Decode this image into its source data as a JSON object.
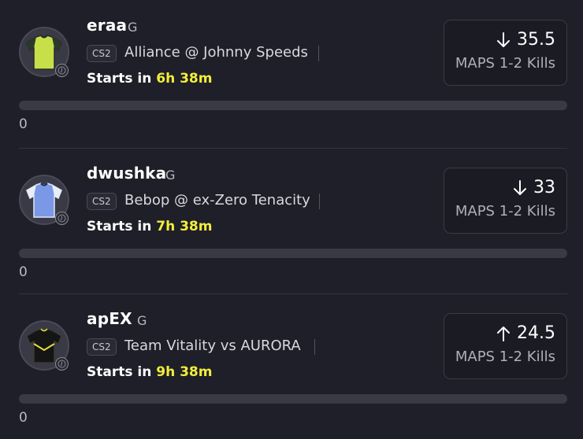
{
  "cards": [
    {
      "player": "eraa",
      "position": "G",
      "game": "CS2",
      "matchup": "Alliance @ Johnny Speeds",
      "starts_prefix": "Starts in",
      "starts_time": "6h 38m",
      "direction": "down",
      "stat_value": "35.5",
      "stat_label": "MAPS 1-2 Kills",
      "progress_value": "0",
      "progress_fraction": 0,
      "jersey_color": "#c7e04a",
      "jersey_trim": "#2a2a2a",
      "jersey_sleeve": "#2a3a2a"
    },
    {
      "player": "dwushka",
      "position": "G",
      "game": "CS2",
      "matchup": "Bebop @ ex-Zero Tenacity",
      "starts_prefix": "Starts in",
      "starts_time": "7h 38m",
      "direction": "down",
      "stat_value": "33",
      "stat_label": "MAPS 1-2 Kills",
      "progress_value": "0",
      "progress_fraction": 0,
      "jersey_color": "#7b98e6",
      "jersey_trim": "#dfe6f5",
      "jersey_sleeve": "#e8eef8"
    },
    {
      "player": "apEX",
      "position": "G",
      "game": "CS2",
      "matchup": "Team Vitality vs AURORA",
      "starts_prefix": "Starts in",
      "starts_time": "9h 38m",
      "direction": "up",
      "stat_value": "24.5",
      "stat_label": "MAPS 1-2 Kills",
      "progress_value": "0",
      "progress_fraction": 0,
      "jersey_color": "#151515",
      "jersey_trim": "#e6e13a",
      "jersey_sleeve": "#151515"
    }
  ],
  "icons": {
    "arrow_down": "arrow-down-icon",
    "arrow_up": "arrow-up-icon",
    "clock": "clock-icon"
  },
  "colors": {
    "background": "#1f1f29",
    "accent_time": "#f2ee3a",
    "card_border": "#3b3b47"
  }
}
